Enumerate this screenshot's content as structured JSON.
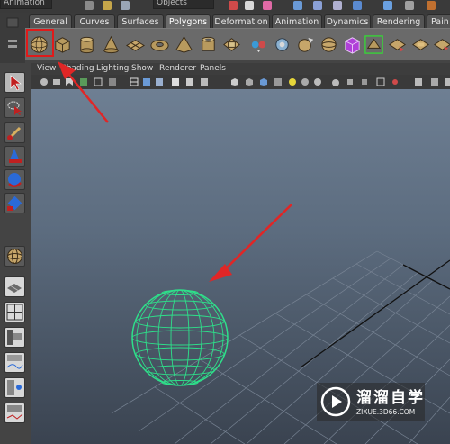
{
  "top_bar": {
    "left_field": "Animation",
    "selection_mode": "Objects"
  },
  "shelf_tabs": [
    {
      "label": "General",
      "active": false
    },
    {
      "label": "Curves",
      "active": false
    },
    {
      "label": "Surfaces",
      "active": false
    },
    {
      "label": "Polygons",
      "active": true
    },
    {
      "label": "Deformation",
      "active": false
    },
    {
      "label": "Animation",
      "active": false
    },
    {
      "label": "Dynamics",
      "active": false
    },
    {
      "label": "Rendering",
      "active": false
    },
    {
      "label": "Pain",
      "active": false
    }
  ],
  "shelf_icons": [
    "poly-sphere-icon",
    "poly-cube-icon",
    "poly-cylinder-icon",
    "poly-cone-icon",
    "poly-plane-icon",
    "poly-torus-icon",
    "poly-pyramid-icon",
    "poly-pipe-icon",
    "poly-helix-icon",
    "combine-icon",
    "separate-icon",
    "extract-icon",
    "smooth-icon",
    "boolean-icon",
    "mirror-icon",
    "extrude-icon",
    "bridge-icon",
    "append-icon"
  ],
  "viewport_menu": [
    "View",
    "Shading",
    "Lighting",
    "Show",
    "Renderer",
    "Panels"
  ],
  "toolbox_icons": [
    "select-tool-icon",
    "lasso-tool-icon",
    "paint-select-icon",
    "move-tool-icon",
    "rotate-tool-icon",
    "scale-tool-icon",
    "sphere-icon",
    "layout-single-icon",
    "layout-four-icon",
    "layout-outliner-icon",
    "layout-graph-icon",
    "layout-hypershade-icon",
    "layout-script-icon"
  ],
  "annotation_color": "#e02626",
  "sphere_color": "#2ee08a",
  "watermark": {
    "title": "溜溜自学",
    "url": "ZIXUE.3D66.COM"
  }
}
